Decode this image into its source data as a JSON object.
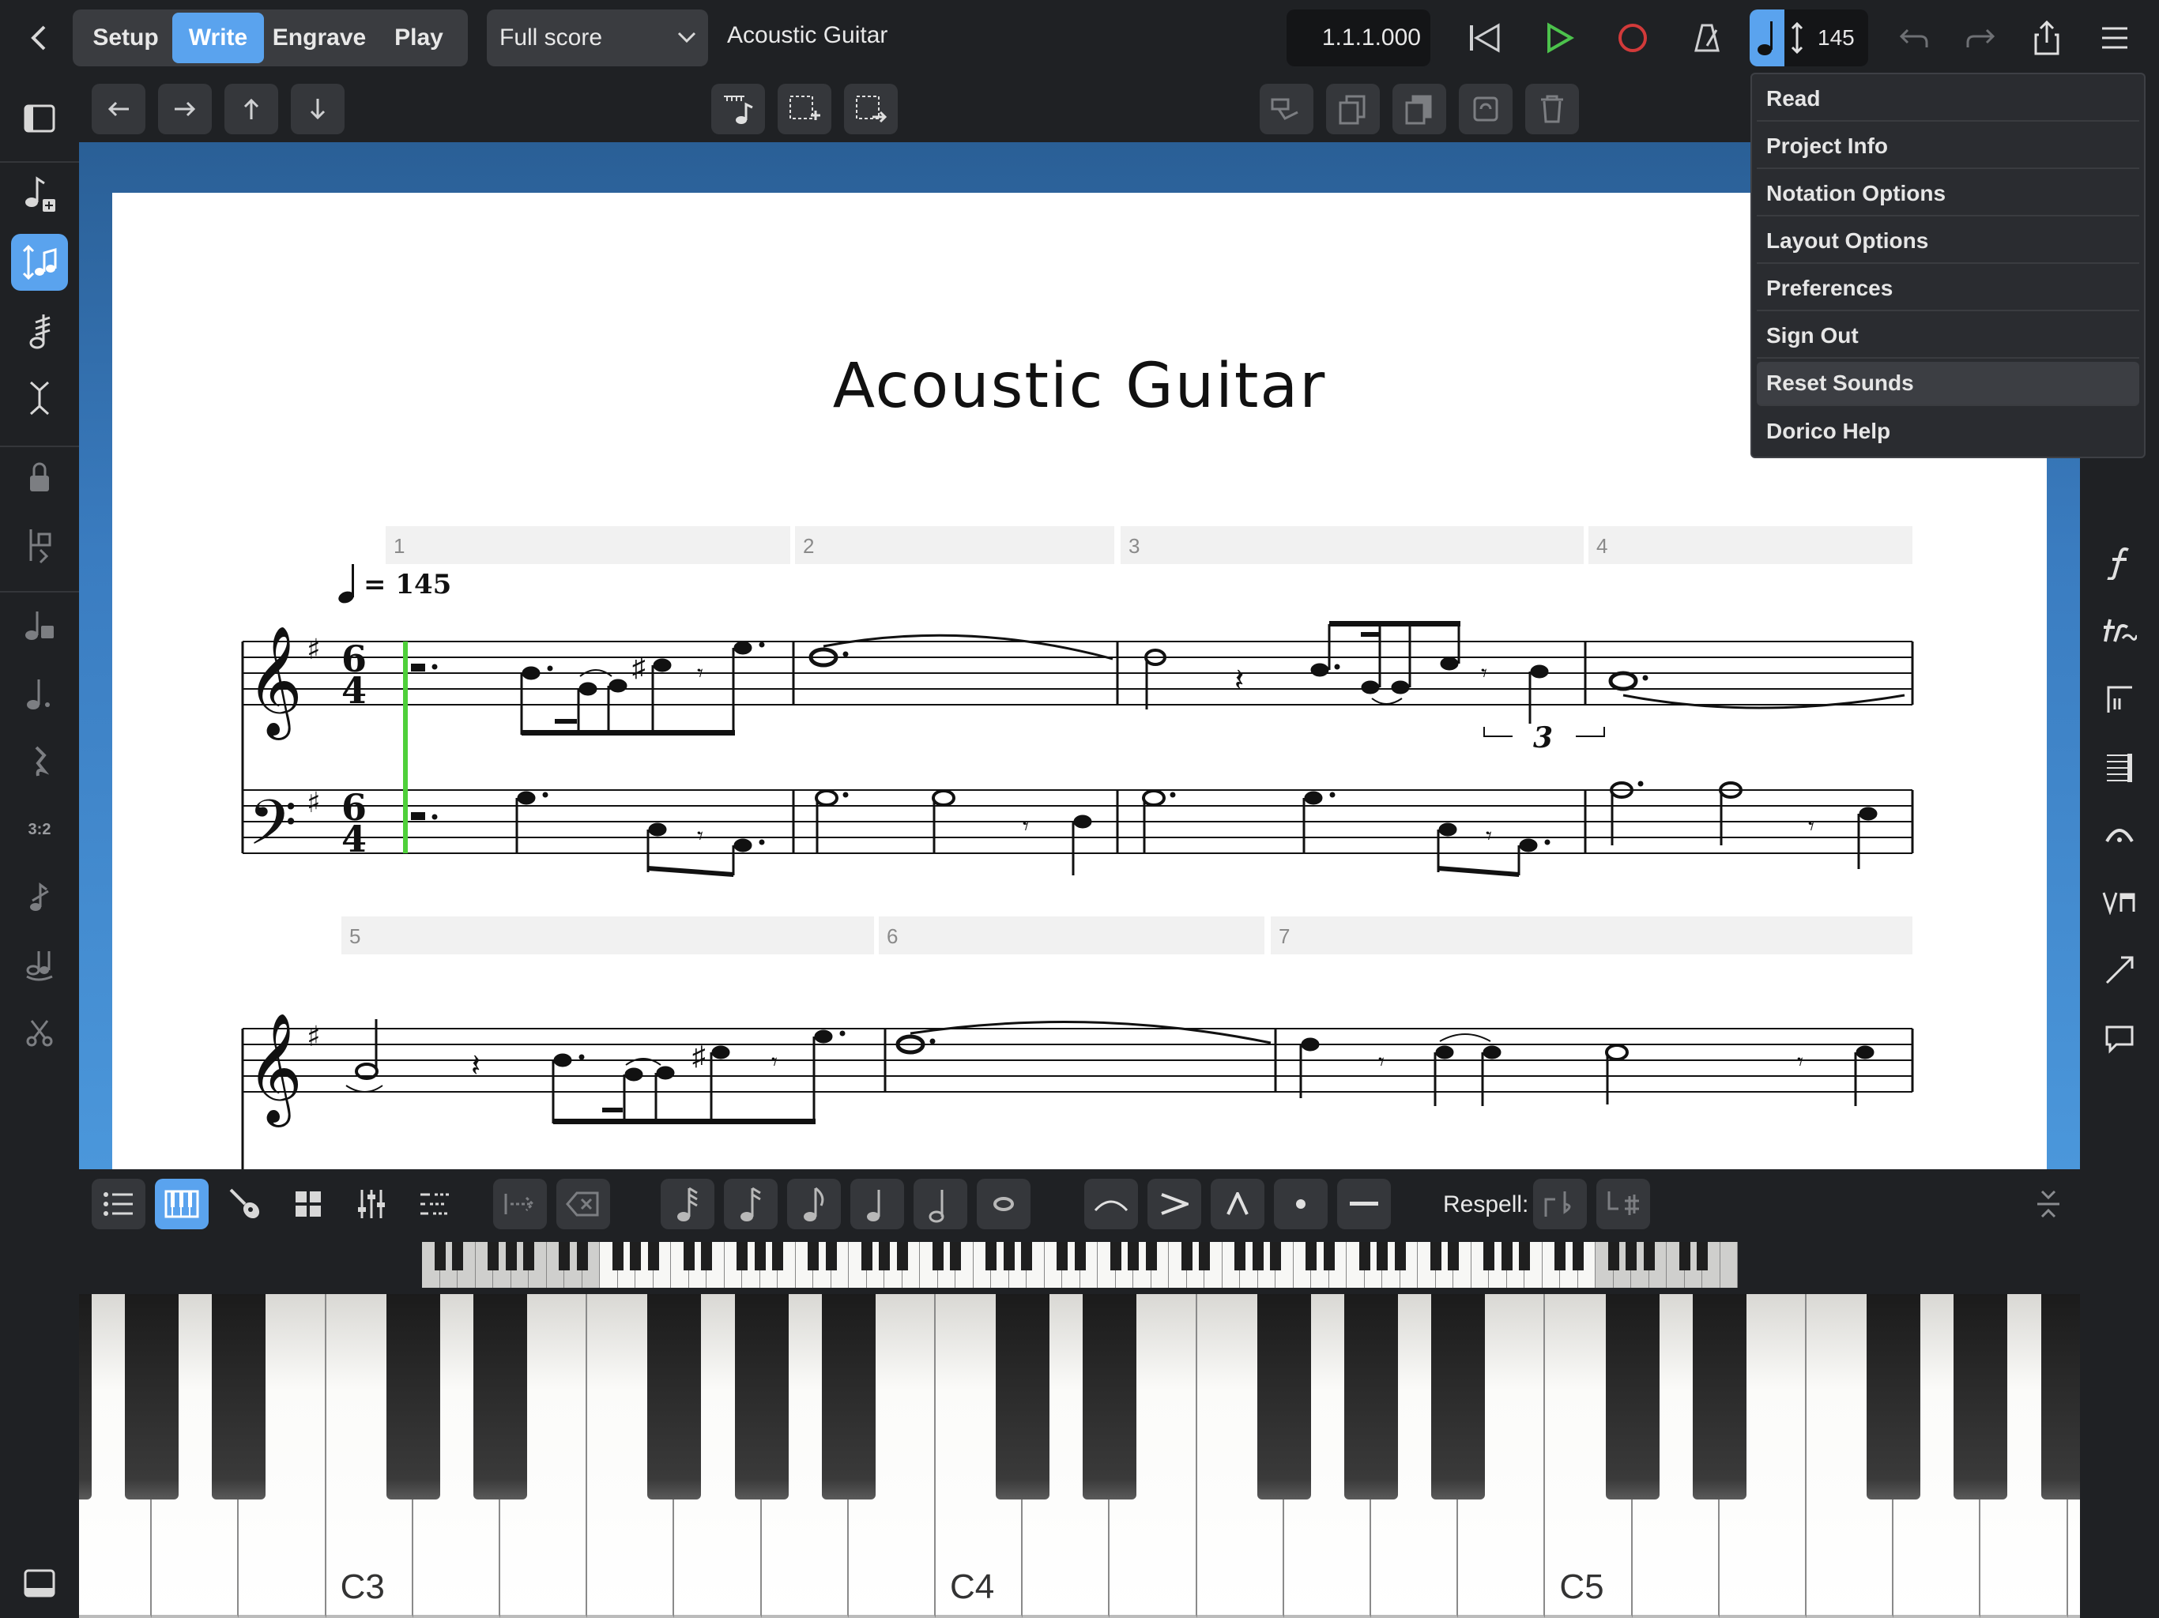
{
  "topbar": {
    "back_label": "‹",
    "modes": [
      {
        "label": "Setup",
        "active": false
      },
      {
        "label": "Write",
        "active": true
      },
      {
        "label": "Engrave",
        "active": false
      },
      {
        "label": "Play",
        "active": false
      }
    ],
    "layout_select": "Full score",
    "title": "Acoustic Guitar",
    "position": "1.1.1.000",
    "tempo": "145",
    "accent_color": "#5aa3ee",
    "play_color": "#4cc24c",
    "record_color": "#d23a3a"
  },
  "menu": {
    "items": [
      {
        "label": "Read",
        "highlighted": false
      },
      {
        "label": "Project Info",
        "highlighted": false
      },
      {
        "label": "Notation Options",
        "highlighted": false
      },
      {
        "label": "Layout Options",
        "highlighted": false
      },
      {
        "label": "Preferences",
        "highlighted": false
      },
      {
        "label": "Sign Out",
        "highlighted": false
      },
      {
        "label": "Reset Sounds",
        "highlighted": true
      },
      {
        "label": "Dorico Help",
        "highlighted": false
      }
    ]
  },
  "leftpanel": {
    "tuplet_label": "3:2"
  },
  "score": {
    "title": "Acoustic Guitar",
    "tempo_mark": "= 145",
    "time_sig_top": "6",
    "time_sig_bottom": "4",
    "bars_system1": [
      "1",
      "2",
      "3",
      "4"
    ],
    "bars_system2": [
      "5",
      "6",
      "7"
    ],
    "tuplet_number": "3",
    "caret_color": "#4fd03a"
  },
  "bottombar": {
    "respell_label": "Respell:"
  },
  "keyboard": {
    "labels": [
      "C3",
      "C4",
      "C5"
    ]
  }
}
